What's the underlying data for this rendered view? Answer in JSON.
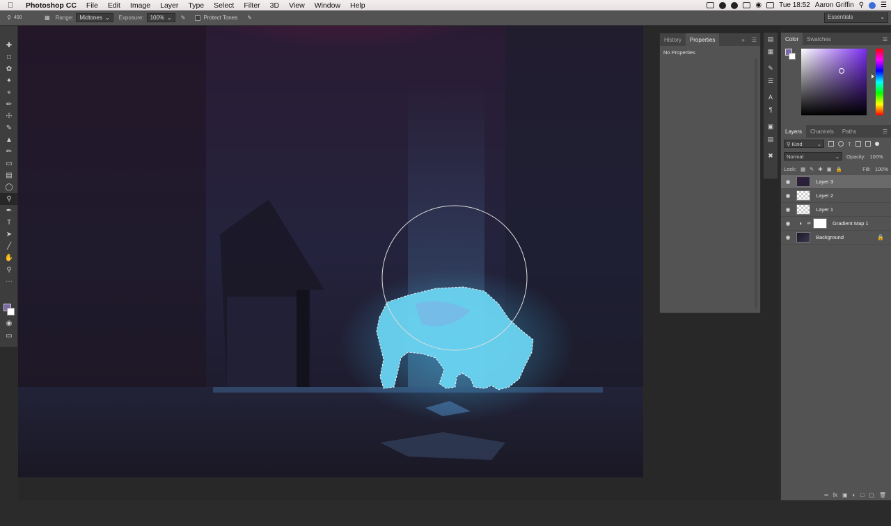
{
  "menubar": {
    "apple": "",
    "items": [
      "Photoshop CC",
      "File",
      "Edit",
      "Image",
      "Layer",
      "Type",
      "Select",
      "Filter",
      "3D",
      "View",
      "Window",
      "Help"
    ],
    "clock": "Tue 18:52",
    "user": "Aaron Griffin"
  },
  "options": {
    "brush_size": "400",
    "range_label": "Range:",
    "range_value": "Midtones",
    "exposure_label": "Exposure:",
    "exposure_value": "100%",
    "protect_tones": "Protect Tones",
    "workspace": "Essentials"
  },
  "tools": [
    "move-tool",
    "marquee-tool",
    "lasso-tool",
    "magic-wand-tool",
    "crop-tool",
    "eyedropper-tool",
    "healing-tool",
    "brush-tool",
    "stamp-tool",
    "history-brush-tool",
    "eraser-tool",
    "gradient-tool",
    "blur-tool",
    "dodge-tool",
    "pen-tool",
    "type-tool",
    "path-select-tool",
    "line-tool",
    "hand-tool",
    "zoom-tool",
    "more-tools"
  ],
  "properties_panel": {
    "tabs": [
      "History",
      "Properties"
    ],
    "active_tab": "Properties",
    "body": "No Properties"
  },
  "color_panel": {
    "tabs": [
      "Color",
      "Swatches"
    ],
    "active_tab": "Color",
    "foreground": "#7a6aa8",
    "background": "#ffffff"
  },
  "layers_panel": {
    "tabs": [
      "Layers",
      "Channels",
      "Paths"
    ],
    "active_tab": "Layers",
    "kind_label": "Kind",
    "blend_mode": "Normal",
    "opacity_label": "Opacity:",
    "opacity_value": "100%",
    "lock_label": "Lock:",
    "fill_label": "Fill:",
    "fill_value": "100%",
    "layers": [
      {
        "name": "Layer 3",
        "thumb": "dark",
        "selected": true
      },
      {
        "name": "Layer 2",
        "thumb": "check",
        "selected": false
      },
      {
        "name": "Layer 1",
        "thumb": "check",
        "selected": false
      },
      {
        "name": "Gradient Map 1",
        "thumb": "white",
        "selected": false,
        "adjustment": true
      },
      {
        "name": "Background",
        "thumb": "bgimg",
        "selected": false,
        "locked": true
      }
    ]
  },
  "canvas": {
    "subject": "glowing bison silhouette with active selection and brush cursor circle"
  }
}
